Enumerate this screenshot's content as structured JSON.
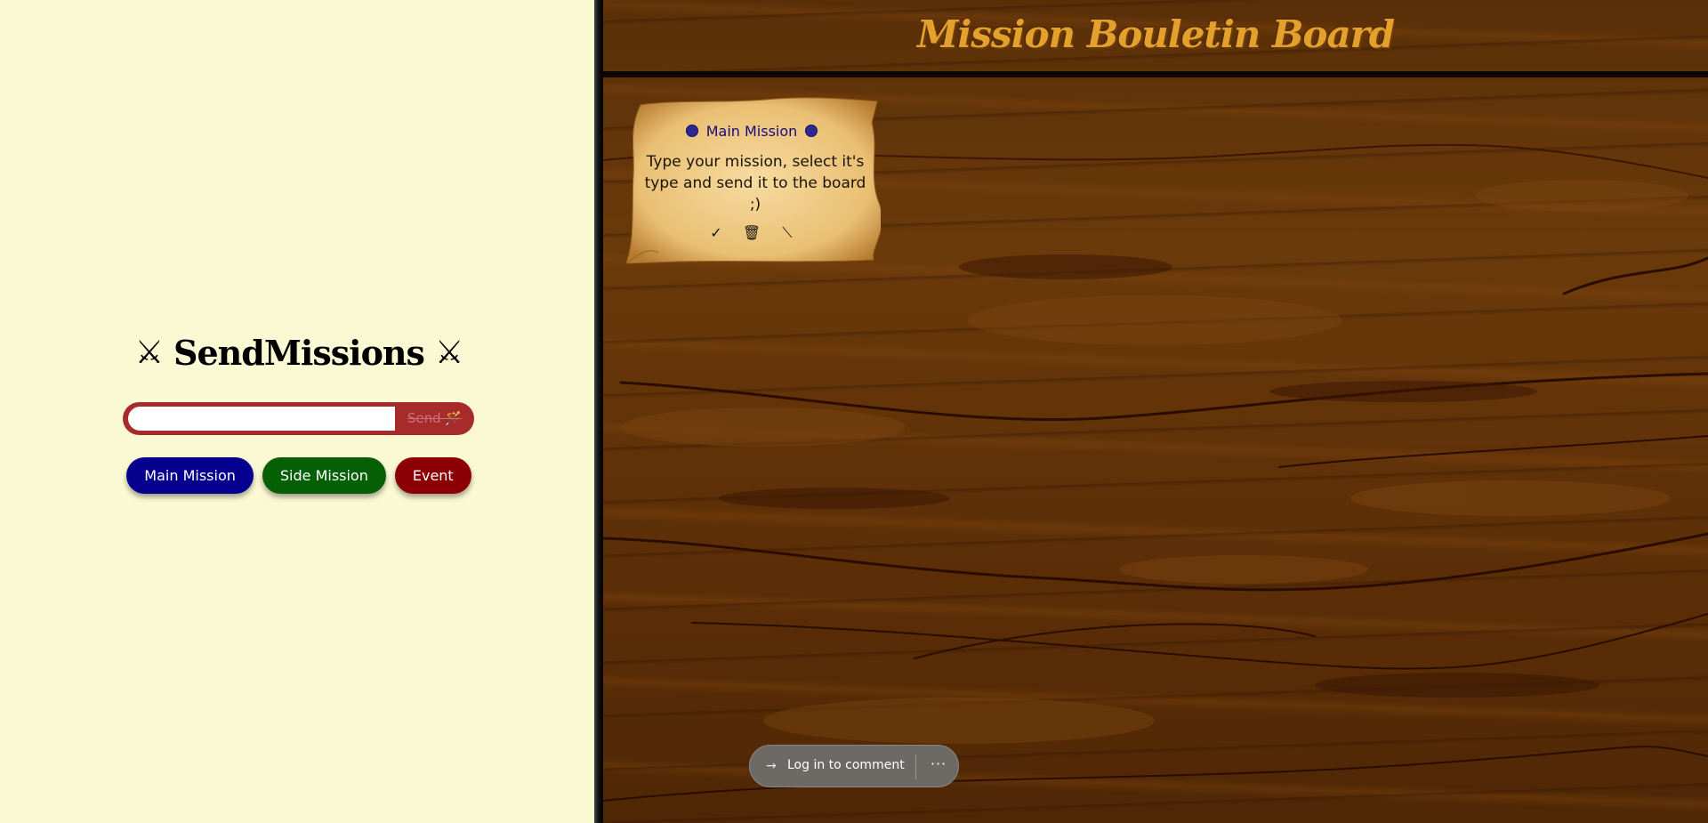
{
  "compose": {
    "title": "SendMissions",
    "swords_left": "⚔",
    "swords_right": "⚔",
    "input_value": "",
    "input_placeholder": "",
    "send_label": "Send 🪄",
    "types": [
      {
        "label": "Main Mission",
        "color": "#05008d"
      },
      {
        "label": "Side Mission",
        "color": "#056005"
      },
      {
        "label": "Event",
        "color": "#8c0005"
      }
    ]
  },
  "board": {
    "title": "Mission Bouletin Board",
    "notes": [
      {
        "type": "Main Mission",
        "text": "Type your mission, select it's type and send it to the board ;)",
        "actions": {
          "complete": "✓",
          "delete": "🗑",
          "edit": "⟍"
        }
      }
    ]
  },
  "comment": {
    "login_label": "Log in to comment",
    "login_icon": "→",
    "more_label": "···"
  },
  "colors": {
    "panel_bg": "#fbf9d3",
    "send_bar": "#a82b2c",
    "board_title": "#e3a02b",
    "note_type_color": "#1a0a80"
  }
}
